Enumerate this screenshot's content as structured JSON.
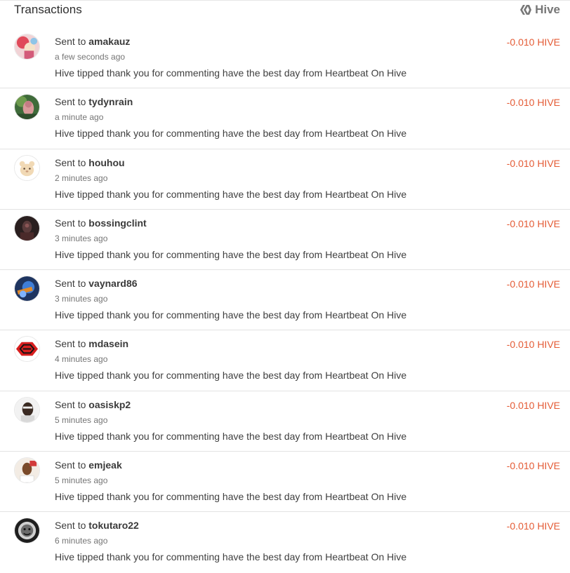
{
  "header": {
    "title": "Transactions",
    "network_label": "Hive",
    "network_icon": "hive-logo-icon"
  },
  "colors": {
    "amount": "#e45b35",
    "divider": "#e3e3e3"
  },
  "transactions": [
    {
      "prefix": "Sent to",
      "recipient": "amakauz",
      "time": "a few seconds ago",
      "memo": "Hive tipped thank you for commenting have the best day from Heartbeat On Hive",
      "amount": "-0.010 HIVE"
    },
    {
      "prefix": "Sent to",
      "recipient": "tydynrain",
      "time": "a minute ago",
      "memo": "Hive tipped thank you for commenting have the best day from Heartbeat On Hive",
      "amount": "-0.010 HIVE"
    },
    {
      "prefix": "Sent to",
      "recipient": "houhou",
      "time": "2 minutes ago",
      "memo": "Hive tipped thank you for commenting have the best day from Heartbeat On Hive",
      "amount": "-0.010 HIVE"
    },
    {
      "prefix": "Sent to",
      "recipient": "bossingclint",
      "time": "3 minutes ago",
      "memo": "Hive tipped thank you for commenting have the best day from Heartbeat On Hive",
      "amount": "-0.010 HIVE"
    },
    {
      "prefix": "Sent to",
      "recipient": "vaynard86",
      "time": "3 minutes ago",
      "memo": "Hive tipped thank you for commenting have the best day from Heartbeat On Hive",
      "amount": "-0.010 HIVE"
    },
    {
      "prefix": "Sent to",
      "recipient": "mdasein",
      "time": "4 minutes ago",
      "memo": "Hive tipped thank you for commenting have the best day from Heartbeat On Hive",
      "amount": "-0.010 HIVE"
    },
    {
      "prefix": "Sent to",
      "recipient": "oasiskp2",
      "time": "5 minutes ago",
      "memo": "Hive tipped thank you for commenting have the best day from Heartbeat On Hive",
      "amount": "-0.010 HIVE"
    },
    {
      "prefix": "Sent to",
      "recipient": "emjeak",
      "time": "5 minutes ago",
      "memo": "Hive tipped thank you for commenting have the best day from Heartbeat On Hive",
      "amount": "-0.010 HIVE"
    },
    {
      "prefix": "Sent to",
      "recipient": "tokutaro22",
      "time": "6 minutes ago",
      "memo": "Hive tipped thank you for commenting have the best day from Heartbeat On Hive",
      "amount": "-0.010 HIVE"
    }
  ]
}
